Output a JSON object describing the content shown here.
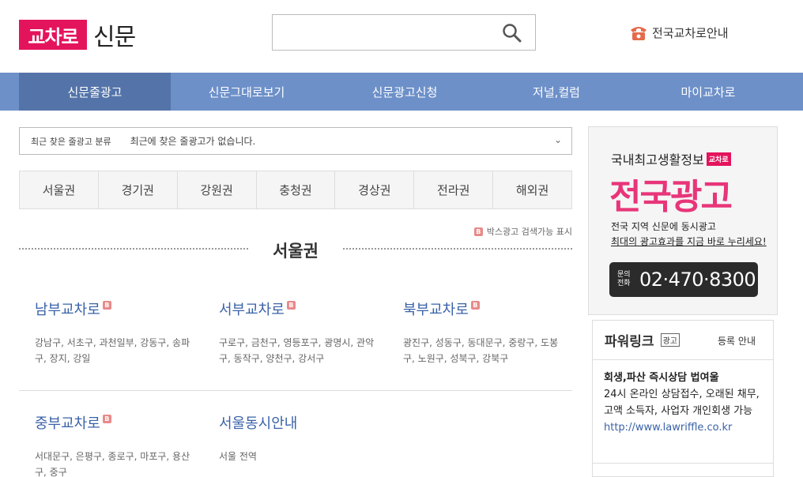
{
  "header": {
    "logo_mark": "교차로",
    "logo_text": "신문",
    "search": {
      "value": "",
      "placeholder": ""
    },
    "guide_label": "전국교차로안내"
  },
  "nav": {
    "items": [
      {
        "label": "신문줄광고",
        "active": true
      },
      {
        "label": "신문그대로보기",
        "active": false
      },
      {
        "label": "신문광고신청",
        "active": false
      },
      {
        "label": "저널,컬럼",
        "active": false
      },
      {
        "label": "마이교차로",
        "active": false
      }
    ]
  },
  "recent": {
    "label": "최근 찾은 줄광고 분류",
    "text": "최근에 찾은 줄광고가 없습니다."
  },
  "regions": [
    "서울권",
    "경기권",
    "강원권",
    "충청권",
    "경상권",
    "전라권",
    "해외권"
  ],
  "box_note": "박스광고 검색가능 표시",
  "section_title": "서울권",
  "branches": [
    {
      "name": "남부교차로",
      "badge": "B",
      "areas": "강남구, 서초구, 과천일부, 강동구, 송파구, 장지, 강일"
    },
    {
      "name": "서부교차로",
      "badge": "B",
      "areas": "구로구, 금천구, 영등포구, 광명시, 관악구, 동작구, 양천구, 강서구"
    },
    {
      "name": "북부교차로",
      "badge": "B",
      "areas": "광진구, 성동구, 동대문구, 중랑구, 도봉구, 노원구, 성북구, 강북구"
    },
    {
      "name": "중부교차로",
      "badge": "B",
      "areas": "서대문구, 은평구, 종로구, 마포구, 용산구, 중구"
    },
    {
      "name": "서울동시안내",
      "badge": "",
      "areas": "서울 전역"
    }
  ],
  "ad": {
    "top": "국내최고생활정보",
    "mini_logo": "교차로",
    "big": "전국광고",
    "line1": "전국 지역 신문에 동시광고",
    "line2": "최대의 광고효과를 지금 바로 누리세요!",
    "call_label": "문의전화",
    "call_number": "02·470·8300"
  },
  "power": {
    "title": "파워링크",
    "ad_tag": "광고",
    "register": "등록 안내",
    "headline": "회생,파산 즉시상담 법여울",
    "desc": "24시 온라인 상담접수, 오래된 채무, 고액 소득자, 사업자 개인회생 가능",
    "url": "http://www.lawriffle.co.kr"
  },
  "colors": {
    "brand": "#e4145c",
    "nav": "#6d90c9",
    "nav_active": "#5474a9",
    "link": "#3a62a8"
  }
}
